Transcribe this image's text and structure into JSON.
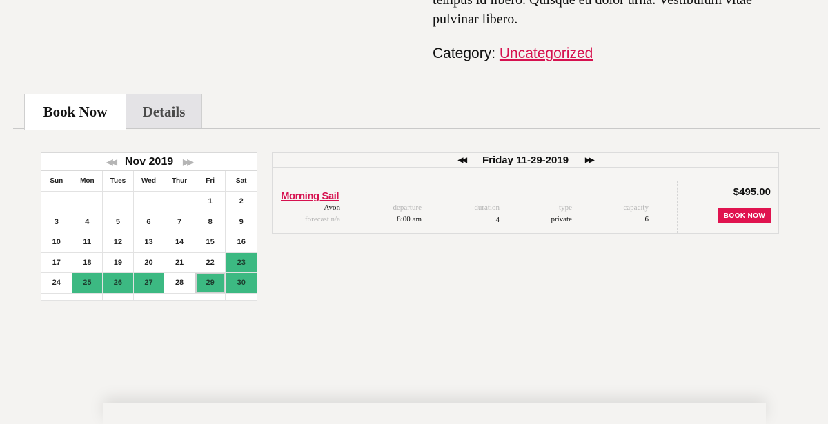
{
  "article": {
    "paragraph_end_line1": "tempus id libero. Quisque eu dolor urna. Vestibulum vitae",
    "paragraph_end_line2": "pulvinar libero.",
    "category_label": "Category:",
    "category_link": "Uncategorized"
  },
  "tabs": [
    {
      "label": "Book Now",
      "active": true
    },
    {
      "label": "Details",
      "active": false
    }
  ],
  "calendar": {
    "month_label": "Nov 2019",
    "prev_icon": "double-left-arrow-icon",
    "next_icon": "double-right-arrow-icon",
    "weekdays": [
      "Sun",
      "Mon",
      "Tues",
      "Wed",
      "Thur",
      "Fri",
      "Sat"
    ],
    "days": [
      "",
      "",
      "",
      "",
      "",
      "1",
      "2",
      "3",
      "4",
      "5",
      "6",
      "7",
      "8",
      "9",
      "10",
      "11",
      "12",
      "13",
      "14",
      "15",
      "16",
      "17",
      "18",
      "19",
      "20",
      "21",
      "22",
      "23",
      "24",
      "25",
      "26",
      "27",
      "28",
      "29",
      "30"
    ],
    "available": [
      "23",
      "25",
      "26",
      "27",
      "29",
      "30"
    ],
    "selected": "29",
    "available_color": "#3cb982"
  },
  "day_panel": {
    "date_label": "Friday 11-29-2019",
    "tour": {
      "name": "Morning Sail",
      "location": "Avon",
      "forecast": "forecast n/a",
      "departure_label": "departure",
      "departure": "8:00 am",
      "duration_label": "duration",
      "duration": "4",
      "type_label": "type",
      "type": "private",
      "capacity_label": "capacity",
      "capacity": "6",
      "price": "$495.00",
      "book_label": "BOOK NOW"
    }
  },
  "colors": {
    "accent": "#d6114f",
    "background": "#f4f3f1"
  }
}
